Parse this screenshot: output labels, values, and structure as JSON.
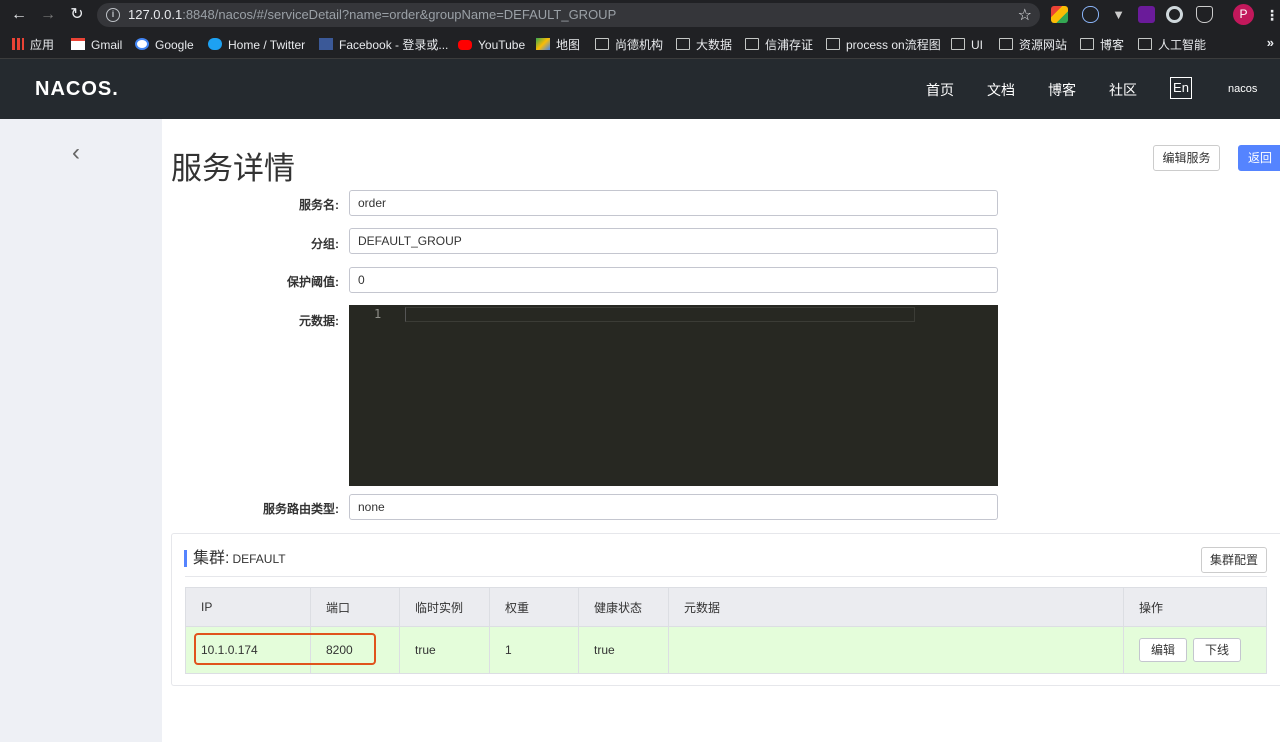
{
  "browser": {
    "url_host": "127.0.0.1",
    "url_rest": ":8848/nacos/#/serviceDetail?name=order&groupName=DEFAULT_GROUP",
    "profile_initial": "P",
    "bookmarks_more": "»",
    "bookmarks": [
      "应用",
      "Gmail",
      "Google",
      "Home / Twitter",
      "Facebook - 登录或...",
      "YouTube",
      "地图",
      "尚德机构",
      "大数据",
      "信浦存证",
      "process on流程图",
      "UI",
      "资源网站",
      "博客",
      "人工智能"
    ]
  },
  "header": {
    "logo": "NACOS.",
    "nav": [
      "首页",
      "文档",
      "博客",
      "社区"
    ],
    "lang": "En",
    "user": "nacos"
  },
  "page": {
    "title": "服务详情",
    "edit_service_label": "编辑服务",
    "back_label": "返回"
  },
  "form": {
    "service_name_label": "服务名:",
    "service_name": "order",
    "group_label": "分组:",
    "group": "DEFAULT_GROUP",
    "threshold_label": "保护阈值:",
    "threshold": "0",
    "metadata_label": "元数据:",
    "metadata_line_no": "1",
    "route_type_label": "服务路由类型:",
    "route_type": "none"
  },
  "cluster": {
    "title": "集群:",
    "name": "DEFAULT",
    "config_label": "集群配置",
    "columns": [
      "IP",
      "端口",
      "临时实例",
      "权重",
      "健康状态",
      "元数据",
      "操作"
    ],
    "rows": [
      {
        "ip": "10.1.0.174",
        "port": "8200",
        "ephemeral": "true",
        "weight": "1",
        "healthy": "true",
        "metadata": "",
        "edit_label": "编辑",
        "offline_label": "下线"
      }
    ]
  },
  "colors": {
    "accent": "#5584ff",
    "header_bg": "#252a2f",
    "row_healthy_bg": "#e4fdda",
    "highlight": "#e0531c"
  }
}
